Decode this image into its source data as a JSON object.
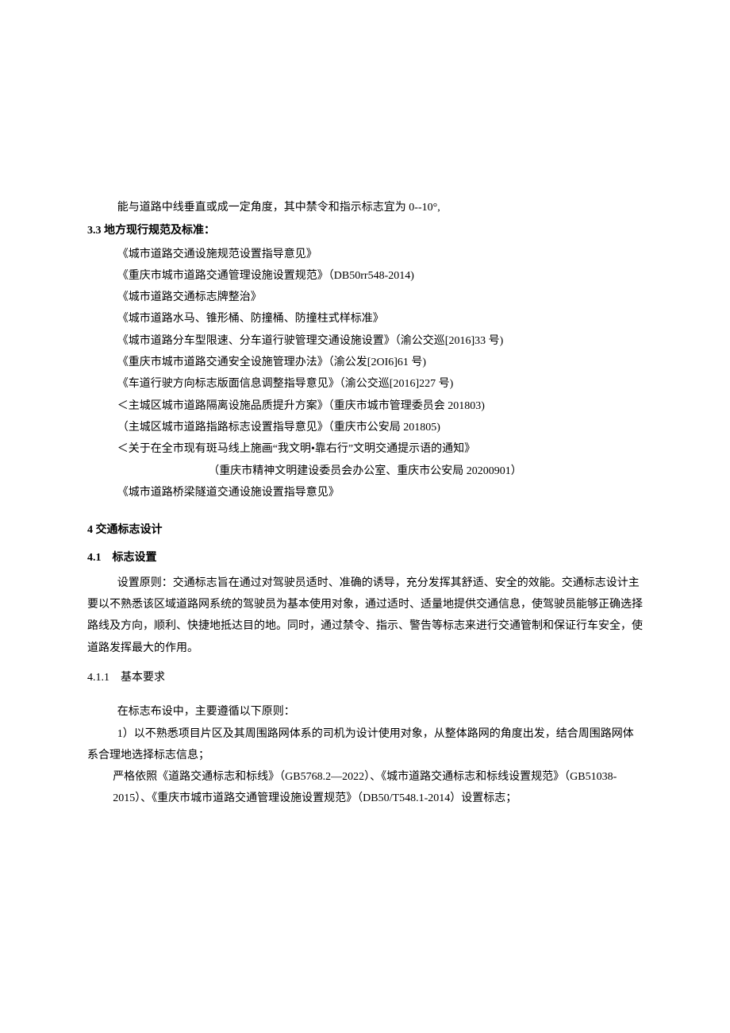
{
  "intro_line": "能与道路中线垂直或成一定角度，其中禁令和指示标志宜为 0--10°,",
  "section_3_3_heading": "3.3 地方现行规范及标准：",
  "regulations": [
    "《城市道路交通设施规范设置指导意见》",
    "《重庆市城市道路交通管理设施设置规范》（DB50rr548-2014)",
    "《城市道路交通标志牌整治》",
    "《城市道路水马、锥形桶、防撞桶、防撞柱式样标准》",
    "《城市道路分车型限速、分车道行驶管理交通设施设置》（渝公交巡[2016]33 号)",
    "《重庆市城市道路交通安全设施管理办法》（渝公发[2OI6]61 号)",
    "《车道行驶方向标志版面信息调整指导意见》（渝公交巡[2016]227 号)",
    "＜主城区城市道路隔离设施品质提升方案》（重庆市城市管理委员会 201803)",
    "（主城区城市道路指路标志设置指导意见》（重庆市公安局 201805)",
    "＜关于在全市现有斑马线上施画“我文明•靠右行”文明交通提示语的通知》"
  ],
  "reg_issuer": "（重庆市精神文明建设委员会办公室、重庆市公安局 20200901）",
  "reg_last": "《城市道路桥梁隧道交通设施设置指导意见》",
  "section_4_heading": "4 交通标志设计",
  "section_4_1_heading": "4.1　标志设置",
  "para_4_1": "设置原则：交通标志旨在通过对驾驶员适时、准确的诱导，充分发挥其舒适、安全的效能。交通标志设计主要以不熟悉该区域道路网系统的驾驶员为基本使用对象，通过适时、适量地提供交通信息，使驾驶员能够正确选择路线及方向，顺利、快捷地抵达目的地。同时，通过禁令、指示、警告等标志来进行交通管制和保证行车安全，使道路发挥最大的作用。",
  "section_4_1_1_heading": "4.1.1　基本要求",
  "para_4_1_1_a": "在标志布设中，主要遵循以下原则：",
  "para_4_1_1_b": "1）以不熟悉项目片区及其周围路网体系的司机为设计使用对象，从整体路网的角度出发，结合周围路网体系合理地选择标志信息；",
  "para_4_1_1_c": "严格依照《道路交通标志和标线》（GB5768.2—2022）、《城市道路交通标志和标线设置规范》（GB51038-",
  "para_4_1_1_d": "2015）、《重庆市城市道路交通管理设施设置规范》（DB50/T548.1-2014）设置标志；"
}
